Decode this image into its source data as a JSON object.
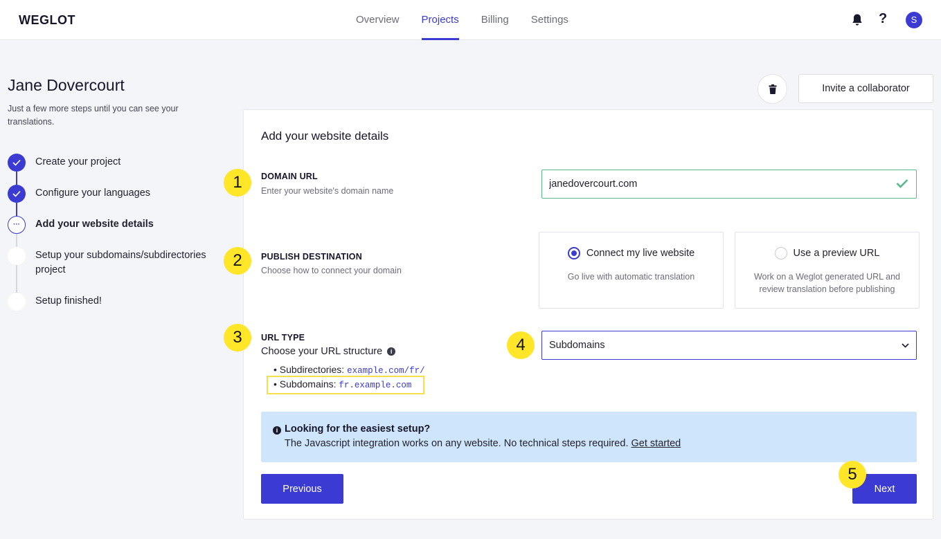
{
  "brand": {
    "logo": "WEGLOT"
  },
  "nav": {
    "items": [
      {
        "label": "Overview"
      },
      {
        "label": "Projects"
      },
      {
        "label": "Billing"
      },
      {
        "label": "Settings"
      }
    ],
    "active": "Projects",
    "help_glyph": "?",
    "avatar_initial": "S"
  },
  "project": {
    "name": "Jane Dovercourt",
    "subtitle": "Just a few more steps until you can see your translations."
  },
  "steps": [
    {
      "label": "Create your project",
      "status": "done"
    },
    {
      "label": "Configure your languages",
      "status": "done"
    },
    {
      "label": "Add your website details",
      "status": "current",
      "glyph": "···"
    },
    {
      "label": "Setup your subdomains/subdirectories project",
      "status": "todo"
    },
    {
      "label": "Setup finished!",
      "status": "todo"
    }
  ],
  "actions": {
    "invite_label": "Invite a collaborator"
  },
  "card": {
    "title": "Add your website details",
    "domain": {
      "label": "DOMAIN URL",
      "description": "Enter your website's domain name",
      "value": "janedovercourt.com"
    },
    "publish": {
      "label": "PUBLISH DESTINATION",
      "description": "Choose how to connect your domain",
      "options": [
        {
          "title": "Connect my live website",
          "description": "Go live with automatic translation",
          "selected": true
        },
        {
          "title": "Use a preview URL",
          "description": "Work on a Weglot generated URL and review translation before publishing",
          "selected": false
        }
      ]
    },
    "url_type": {
      "label": "URL TYPE",
      "description": "Choose your URL structure",
      "info_glyph": "i",
      "examples": [
        {
          "prefix": "Subdirectories:",
          "example": "example.com/fr/"
        },
        {
          "prefix": "Subdomains:",
          "example": "fr.example.com"
        }
      ],
      "selected": "Subdomains"
    },
    "banner": {
      "info_glyph": "i",
      "title": "Looking for the easiest setup?",
      "text": "The Javascript integration works on any website. No technical steps required.",
      "link": "Get started"
    },
    "previous_label": "Previous",
    "next_label": "Next"
  },
  "annotations": [
    "1",
    "2",
    "3",
    "4",
    "5"
  ],
  "colors": {
    "accent": "#3b3bd4",
    "success": "#58b887",
    "highlight": "#ffe629",
    "banner_bg": "#cfe5fb"
  }
}
